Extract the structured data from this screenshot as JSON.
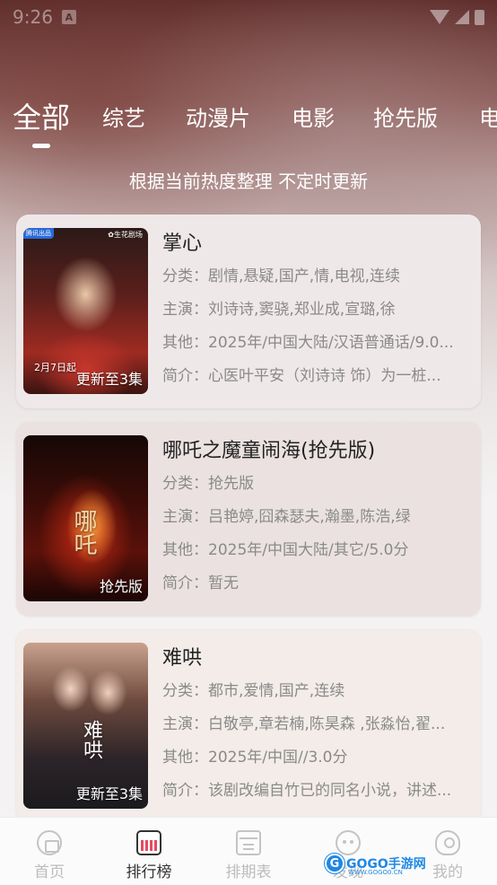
{
  "status_bar": {
    "time": "9:26",
    "notif_glyph": "A",
    "icons": [
      "notification-icon",
      "wifi-icon",
      "signal-icon",
      "battery-icon"
    ]
  },
  "tabs": [
    {
      "label": "全部",
      "active": true
    },
    {
      "label": "综艺",
      "active": false
    },
    {
      "label": "动漫片",
      "active": false
    },
    {
      "label": "电影",
      "active": false
    },
    {
      "label": "抢先版",
      "active": false
    },
    {
      "label": "电",
      "active": false
    }
  ],
  "subtitle": "根据当前热度整理 不定时更新",
  "cards": [
    {
      "title": "掌心",
      "poster_badge": "腾讯出品",
      "poster_logo": "✿生花剧场",
      "poster_date": "2月7日起",
      "poster_label": "更新至3集",
      "category_key": "分类：",
      "category": "剧情,悬疑,国产,情,电视,连续",
      "cast_key": "主演：",
      "cast": "刘诗诗,窦骁,郑业成,宣璐,徐",
      "other_key": "其他：",
      "other": "2025年/中国大陆/汉语普通话/9.0...",
      "intro_key": "简介：",
      "intro": "心医叶平安（刘诗诗 饰）为一桩..."
    },
    {
      "title": "哪吒之魔童闹海(抢先版)",
      "poster_art_title": "哪吒",
      "poster_label": "抢先版",
      "category_key": "分类：",
      "category": "抢先版",
      "cast_key": "主演：",
      "cast": "吕艳婷,囧森瑟夫,瀚墨,陈浩,绿",
      "other_key": "其他：",
      "other": "2025年/中国大陆/其它/5.0分",
      "intro_key": "简介：",
      "intro": "暂无"
    },
    {
      "title": "难哄",
      "poster_art_title": "难哄",
      "poster_label": "更新至3集",
      "category_key": "分类：",
      "category": "都市,爱情,国产,连续",
      "cast_key": "主演：",
      "cast": "白敬亭,章若楠,陈昊森 ,张淼怡,翟...",
      "other_key": "其他：",
      "other": "2025年/中国//3.0分",
      "intro_key": "简介：",
      "intro": "该剧改编自竹已的同名小说，讲述..."
    }
  ],
  "bottom_nav": [
    {
      "label": "首页",
      "icon": "home-icon",
      "active": false
    },
    {
      "label": "排行榜",
      "icon": "ranking-icon",
      "active": true
    },
    {
      "label": "排期表",
      "icon": "schedule-icon",
      "active": false
    },
    {
      "label": "发现",
      "icon": "discover-icon",
      "active": false
    },
    {
      "label": "我的",
      "icon": "profile-icon",
      "active": false
    }
  ],
  "watermark": {
    "logo_glyph": "G",
    "text": "GOGO手游网",
    "sub": "WWW.GOGO0.CN"
  },
  "colors": {
    "header_top": "#5e2d2b",
    "page_bg": "#f4f2f2",
    "accent": "#e84a5f",
    "watermark_blue": "#1e88e5"
  }
}
